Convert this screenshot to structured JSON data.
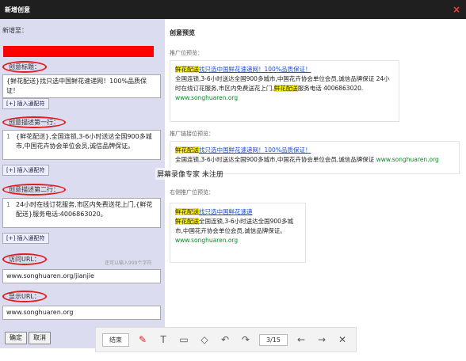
{
  "window": {
    "title": "新增创意",
    "close_glyph": "×"
  },
  "form": {
    "plan_label": "新增至：",
    "title_label": "创意标题：",
    "title_value": "{鲜花配送}找只选中国鲜花速递网！100%品质保证！",
    "insert_label": "[+] 插入通配符",
    "desc1_label": "创意描述第一行：",
    "desc1_num": "1",
    "desc1_value": "{鲜花配送},全国连锁,3-6小时送达全国900多城市,中国花卉协会单位会员,诚信品牌保证。",
    "desc2_label": "创意描述第二行：",
    "desc2_num": "1",
    "desc2_value": "24小时在线订花服务,市区内免费送花上门,{鲜花配送}服务电话:4006863020。",
    "visit_url_label": "访问URL：",
    "visit_url_hint": "还可以输入999个字符",
    "visit_url_value": "www.songhuaren.org/jianjie",
    "display_url_label": "显示URL：",
    "display_url_value": "www.songhuaren.org",
    "ok_button": "确定",
    "cancel_button": "取消"
  },
  "preview": {
    "title": "创意预览",
    "section1": "推广位预览：",
    "section2": "推广链接位预览：",
    "section3": "右侧推广位预览：",
    "card1": {
      "hl": "鲜花配送",
      "title_rest": "找只选中国鲜花速递网！100%品质保证！",
      "desc_a": "全国连锁,3-6小时送达全国900多城市,中国花卉协会单位会员,诚信品牌保证 24小时在线订花服务,市区内免费送花上门,",
      "hl2": "鲜花配送",
      "desc_b": "服务电话 4006863020.",
      "url": "www.songhuaren.org"
    },
    "card2": {
      "hl": "鲜花配送",
      "title_rest": "找只选中国鲜花速递网！100%品质保证！",
      "desc": "全国连锁,3-6小时送达全国900多城市,中国花卉协会单位会员,诚信品牌保证",
      "url": "www.songhuaren.org"
    },
    "card3": {
      "hl": "鲜花配送",
      "title_rest": "找只选中国鲜花速递",
      "hl2": "鲜花配送",
      "desc": "全国连锁,3-6小时送达全国900多城市,中国花卉协会单位会员,诚信品牌保证。",
      "url": "www.songhuaren.org"
    },
    "watermark": "屏幕录像专家 未注册"
  },
  "toolbar": {
    "end_label": "结束",
    "page": "3/15",
    "icons": [
      "pen-icon",
      "text-icon",
      "comment-icon",
      "eraser-icon",
      "undo-icon",
      "redo-icon",
      "prev-icon",
      "next-icon",
      "close-icon"
    ]
  }
}
